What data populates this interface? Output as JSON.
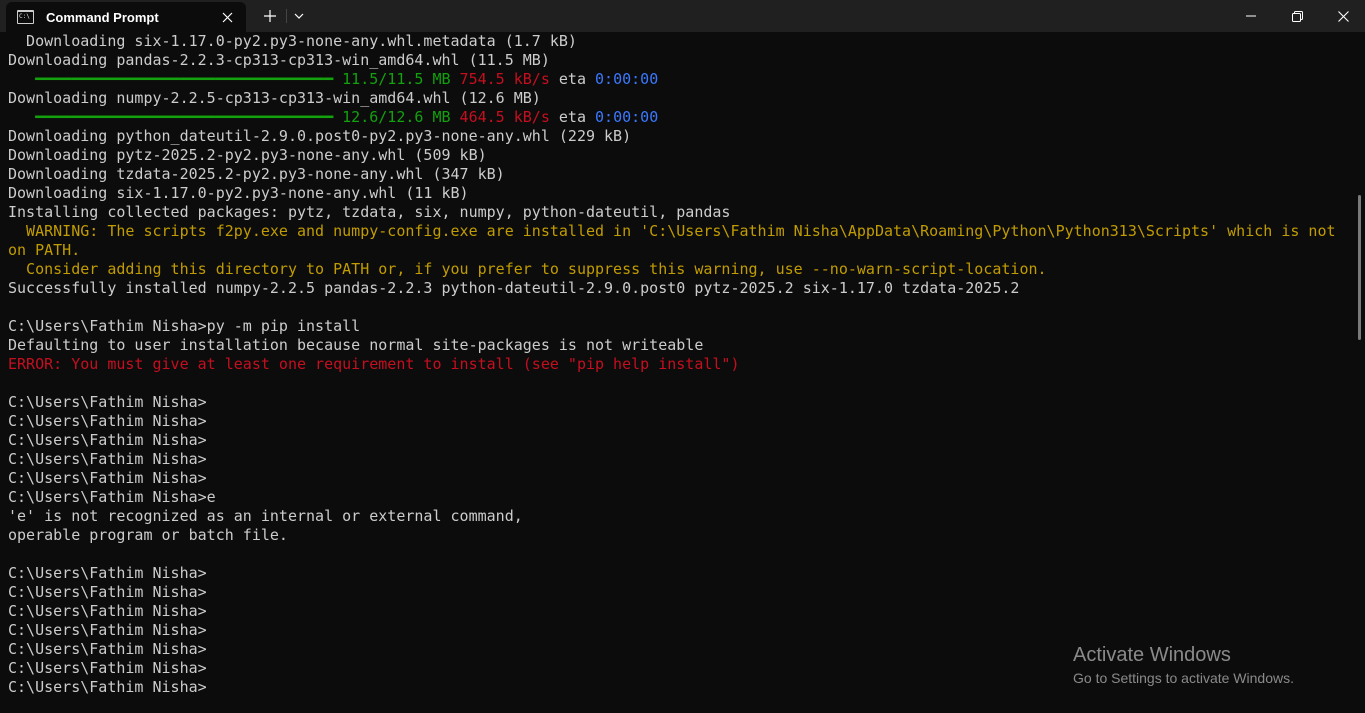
{
  "window": {
    "tab_title": "Command Prompt",
    "tab_icon_text": "C:\\",
    "icons": {
      "tab": "cmd-icon",
      "close_tab": "close-icon",
      "new_tab": "plus-icon",
      "dropdown": "chevron-down-icon",
      "minimize": "minimize-icon",
      "maximize": "restore-icon",
      "close": "close-icon"
    }
  },
  "colors": {
    "background": "#0c0c0c",
    "text": "#cccccc",
    "green": "#13a10e",
    "red": "#c50f1f",
    "blue": "#3b78ff",
    "yellow": "#c19c00"
  },
  "terminal": {
    "l01": "  Downloading six-1.17.0-py2.py3-none-any.whl.metadata (1.7 kB)",
    "l02": "Downloading pandas-2.2.3-cp313-cp313-win_amd64.whl (11.5 MB)",
    "p1": {
      "bar": "   ━━━━━━━━━━━━━━━━━━━━━━━━━━━━━━━━━ ",
      "size": "11.5/11.5 MB",
      "speed": "754.5 kB/s",
      "eta_label": " eta ",
      "eta": "0:00:00"
    },
    "l04": "Downloading numpy-2.2.5-cp313-cp313-win_amd64.whl (12.6 MB)",
    "p2": {
      "bar": "   ━━━━━━━━━━━━━━━━━━━━━━━━━━━━━━━━━ ",
      "size": "12.6/12.6 MB",
      "speed": "464.5 kB/s",
      "eta_label": " eta ",
      "eta": "0:00:00"
    },
    "l06": "Downloading python_dateutil-2.9.0.post0-py2.py3-none-any.whl (229 kB)",
    "l07": "Downloading pytz-2025.2-py2.py3-none-any.whl (509 kB)",
    "l08": "Downloading tzdata-2025.2-py2.py3-none-any.whl (347 kB)",
    "l09": "Downloading six-1.17.0-py2.py3-none-any.whl (11 kB)",
    "l10": "Installing collected packages: pytz, tzdata, six, numpy, python-dateutil, pandas",
    "l11": "  WARNING: The scripts f2py.exe and numpy-config.exe are installed in 'C:\\Users\\Fathim Nisha\\AppData\\Roaming\\Python\\Python313\\Scripts' which is not",
    "l12": "on PATH.",
    "l13": "  Consider adding this directory to PATH or, if you prefer to suppress this warning, use --no-warn-script-location.",
    "l14": "Successfully installed numpy-2.2.5 pandas-2.2.3 python-dateutil-2.9.0.post0 pytz-2025.2 six-1.17.0 tzdata-2025.2",
    "l15": "",
    "l16": "C:\\Users\\Fathim Nisha>py -m pip install",
    "l17": "Defaulting to user installation because normal site-packages is not writeable",
    "l18": "ERROR: You must give at least one requirement to install (see \"pip help install\")",
    "l19": "",
    "l20": "C:\\Users\\Fathim Nisha>",
    "l21": "C:\\Users\\Fathim Nisha>",
    "l22": "C:\\Users\\Fathim Nisha>",
    "l23": "C:\\Users\\Fathim Nisha>",
    "l24": "C:\\Users\\Fathim Nisha>",
    "l25": "C:\\Users\\Fathim Nisha>e",
    "l26": "'e' is not recognized as an internal or external command,",
    "l27": "operable program or batch file.",
    "l28": "",
    "l29": "C:\\Users\\Fathim Nisha>",
    "l30": "C:\\Users\\Fathim Nisha>",
    "l31": "C:\\Users\\Fathim Nisha>",
    "l32": "C:\\Users\\Fathim Nisha>",
    "l33": "C:\\Users\\Fathim Nisha>",
    "l34": "C:\\Users\\Fathim Nisha>",
    "l35": "C:\\Users\\Fathim Nisha>"
  },
  "watermark": {
    "title": "Activate Windows",
    "subtitle": "Go to Settings to activate Windows."
  }
}
